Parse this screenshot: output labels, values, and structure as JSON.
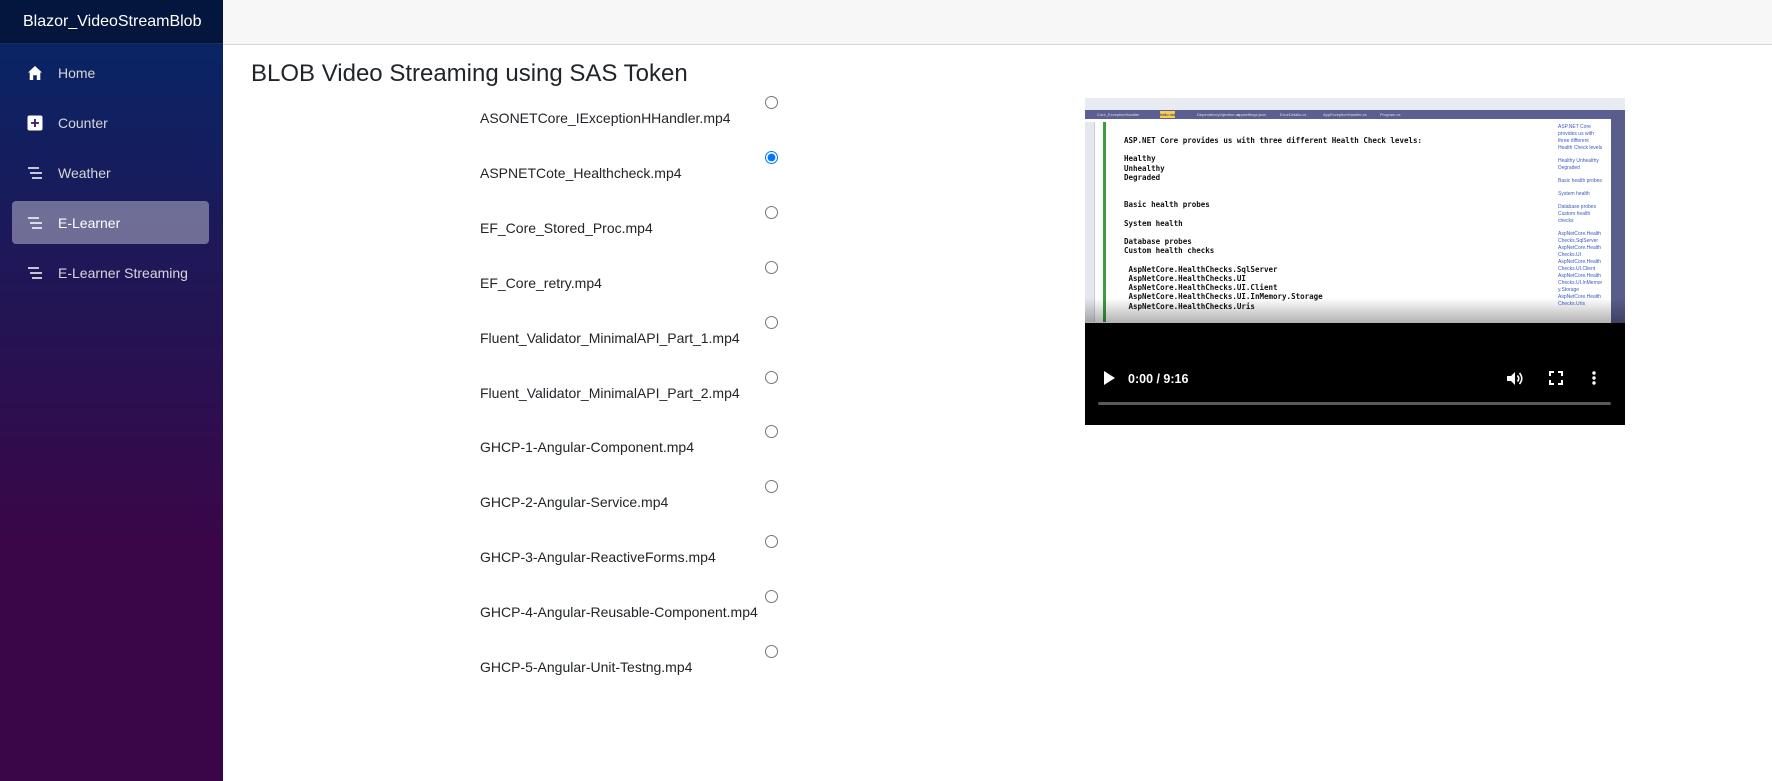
{
  "app": {
    "brand": "Blazor_VideoStreamBlob"
  },
  "nav": [
    {
      "label": "Home",
      "icon": "home-icon",
      "active": false
    },
    {
      "label": "Counter",
      "icon": "plus-icon",
      "active": false
    },
    {
      "label": "Weather",
      "icon": "list-icon",
      "active": false
    },
    {
      "label": "E-Learner",
      "icon": "list-icon",
      "active": true
    },
    {
      "label": "E-Learner Streaming",
      "icon": "list-icon",
      "active": false
    }
  ],
  "page": {
    "title": "BLOB Video Streaming using SAS Token"
  },
  "files": [
    {
      "name": "ASONETCore_IExceptionHHandler.mp4",
      "selected": false
    },
    {
      "name": "ASPNETCote_Healthcheck.mp4",
      "selected": true
    },
    {
      "name": "EF_Core_Stored_Proc.mp4",
      "selected": false
    },
    {
      "name": "EF_Core_retry.mp4",
      "selected": false
    },
    {
      "name": "Fluent_Validator_MinimalAPI_Part_1.mp4",
      "selected": false
    },
    {
      "name": "Fluent_Validator_MinimalAPI_Part_2.mp4",
      "selected": false
    },
    {
      "name": "GHCP-1-Angular-Component.mp4",
      "selected": false
    },
    {
      "name": "GHCP-2-Angular-Service.mp4",
      "selected": false
    },
    {
      "name": "GHCP-3-Angular-ReactiveForms.mp4",
      "selected": false
    },
    {
      "name": "GHCP-4-Angular-Reusable-Component.mp4",
      "selected": false
    },
    {
      "name": "GHCP-5-Angular-Unit-Testng.mp4",
      "selected": false
    }
  ],
  "video": {
    "time": "0:00 / 9:16",
    "frame_tabs": [
      "Core_ExceptionHandler",
      "hello.md",
      "DependencyInjection.cs",
      "appsettings.json",
      "ErrorDetails.cs",
      "AppExceptionHandler.cs",
      "Program.cs"
    ],
    "frame_code": "ASP.NET Core provides us with three different Health Check levels:\n\nHealthy\nUnhealthy\nDegraded\n\n\nBasic health probes\n\nSystem health\n\nDatabase probes\nCustom health checks\n\n AspNetCore.HealthChecks.SqlServer\n AspNetCore.HealthChecks.UI\n AspNetCore.HealthChecks.UI.Client\n AspNetCore.HealthChecks.UI.InMemory.Storage\n AspNetCore.HealthChecks.Uris",
    "frame_side": [
      "ASP.NET Core provides us with three different Health Check levels",
      "Healthy Unhealthy Degraded",
      "Basic health probes",
      "System health",
      "Database probes Custom health checks",
      "AspNetCore.Health Checks.SqlServer AspNetCore.Health Checks.UI AspNetCore.Health Checks.UI.Client AspNetCore.Health Checks.UI.InMemor y.Storage AspNetCore.Health Checks.Uris"
    ],
    "progress": 0
  }
}
